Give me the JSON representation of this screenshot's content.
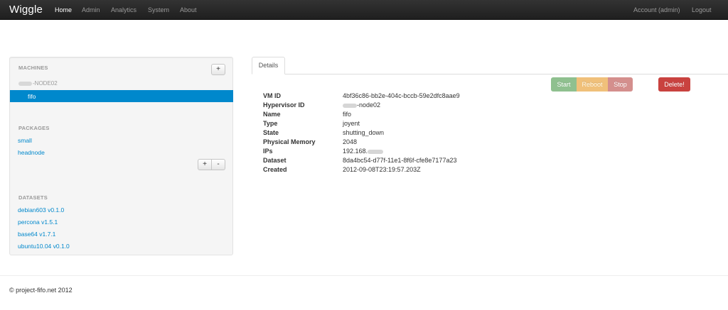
{
  "navbar": {
    "brand": "Wiggle",
    "items": [
      {
        "label": "Home",
        "active": true
      },
      {
        "label": "Admin"
      },
      {
        "label": "Analytics"
      },
      {
        "label": "System"
      },
      {
        "label": "About"
      }
    ],
    "account": "Account (admin)",
    "logout": "Logout"
  },
  "sidebar": {
    "machines_header": "MACHINES",
    "add_machine": "+",
    "node": "-NODE02",
    "selected_machine": "fifo",
    "packages_header": "PACKAGES",
    "packages": [
      "small",
      "headnode"
    ],
    "add_package": "+",
    "remove_package": "-",
    "datasets_header": "DATASETS",
    "datasets": [
      "debian603 v0.1.0",
      "percona v1.5.1",
      "base64 v1.7.1",
      "ubuntu10.04 v0.1.0"
    ]
  },
  "tabs": {
    "details": "Details"
  },
  "actions": {
    "start": "Start",
    "reboot": "Reboot",
    "stop": "Stop",
    "delete": "Delete!"
  },
  "details": {
    "labels": [
      "VM ID",
      "Hypervisor ID",
      "Name",
      "Type",
      "State",
      "Physical Memory",
      "IPs",
      "Dataset",
      "Created"
    ],
    "vm_id": "4bf36c86-bb2e-404c-bccb-59e2dfc8aae9",
    "hypervisor_id": "-node02",
    "name": "fifo",
    "type": "joyent",
    "state": "shutting_down",
    "memory": "2048",
    "ip": "192.168.",
    "dataset": "8da4bc54-d77f-11e1-8f6f-cfe8e7177a23",
    "created": "2012-09-08T23:19:57.203Z"
  },
  "footer": "© project-fifo.net 2012",
  "colors": {
    "link": "#0088cc",
    "start": "#8fc08f",
    "reboot": "#f0c07a",
    "stop": "#d48f8d",
    "delete": "#c9423f"
  }
}
